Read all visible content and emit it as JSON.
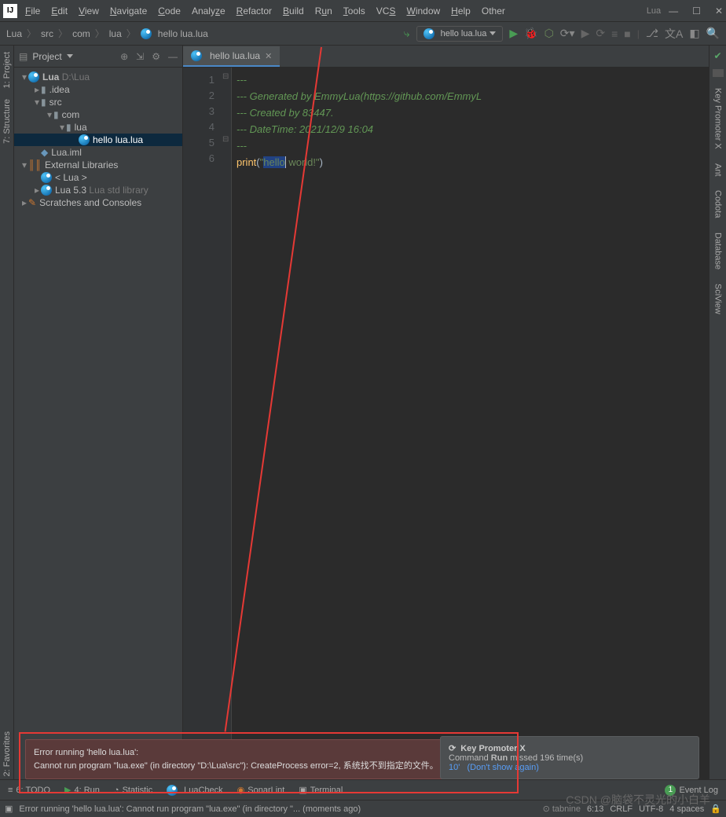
{
  "menu": {
    "file": "File",
    "edit": "Edit",
    "view": "View",
    "navigate": "Navigate",
    "code": "Code",
    "analyze": "Analyze",
    "refactor": "Refactor",
    "build": "Build",
    "run": "Run",
    "tools": "Tools",
    "vcs": "VCS",
    "window": "Window",
    "help": "Help",
    "other": "Other"
  },
  "title_hint": "Lua",
  "breadcrumbs": {
    "p0": "Lua",
    "p1": "src",
    "p2": "com",
    "p3": "lua",
    "p4": "hello lua.lua"
  },
  "run_config": "hello lua.lua",
  "sidetabs": {
    "project": "1: Project",
    "structure": "7: Structure",
    "favorites": "2: Favorites",
    "keypx": "Key Promoter X",
    "ant": "Ant",
    "codota": "Codota",
    "database": "Database",
    "sciview": "SciView"
  },
  "panel": {
    "title": "Project"
  },
  "tree": {
    "root": "Lua",
    "root_path": "D:\\Lua",
    "idea": ".idea",
    "src": "src",
    "com": "com",
    "lua": "lua",
    "file": "hello lua.lua",
    "iml": "Lua.iml",
    "ext": "External Libraries",
    "lua_lib": "< Lua >",
    "lua53": "Lua 5.3",
    "lua53_desc": "Lua std library",
    "scratch": "Scratches and Consoles"
  },
  "tab": {
    "name": "hello lua.lua"
  },
  "code": {
    "l1": "---",
    "l2": "--- Generated by EmmyLua(https://github.com/EmmyL",
    "l3": "--- Created by 83447.",
    "l4": "--- DateTime: 2021/12/9 16:04",
    "l5": "---",
    "l6_fn": "print",
    "l6_open": "(",
    "l6_q1": "\"",
    "l6_hello": "hello",
    "l6_rest": " world!\"",
    "l6_close": ")"
  },
  "gutter": [
    "1",
    "2",
    "3",
    "4",
    "5",
    "6"
  ],
  "error_popup": {
    "line1": "Error running 'hello lua.lua':",
    "line2": "Cannot run program \"lua.exe\" (in directory \"D:\\Lua\\src\"): CreateProcess error=2, 系统找不到指定的文件。"
  },
  "key_promo": {
    "title": "Key Promoter X",
    "msg1": "Command ",
    "msg2": "Run",
    "msg3": " missed 196 time(s)",
    "short": "10'",
    "link": "(Don't show again)"
  },
  "bottom": {
    "todo": "6: TODO",
    "run": "4: Run",
    "stat": "Statistic",
    "luacheck": "LuaCheck",
    "sonar": "SonarLint",
    "terminal": "Terminal",
    "event": "Event Log",
    "badge": "1"
  },
  "status": {
    "msg": "Error running 'hello lua.lua': Cannot run program \"lua.exe\" (in directory \"... (moments ago)",
    "tabnine": "tabnine",
    "pos": "6:13",
    "enc": "CRLF",
    "sp": "UTF-8",
    "ind": "4 spaces"
  },
  "watermark": "CSDN @脑袋不灵光的小白羊"
}
